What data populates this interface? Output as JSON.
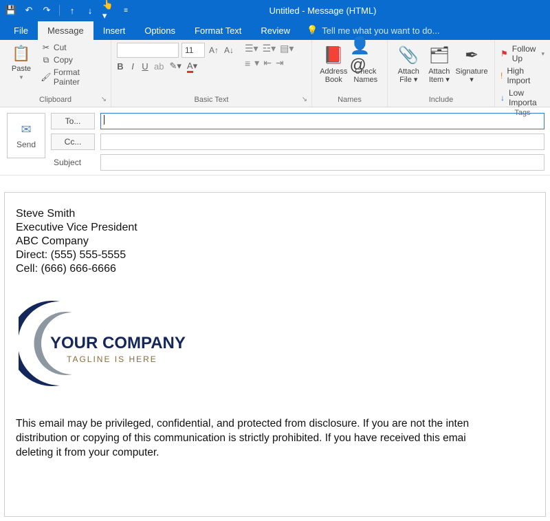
{
  "window": {
    "title": "Untitled - Message (HTML)"
  },
  "tabs": {
    "file": "File",
    "message": "Message",
    "insert": "Insert",
    "options": "Options",
    "format_text": "Format Text",
    "review": "Review",
    "tellme": "Tell me what you want to do..."
  },
  "ribbon": {
    "clipboard": {
      "label": "Clipboard",
      "paste": "Paste",
      "cut": "Cut",
      "copy": "Copy",
      "format_painter": "Format Painter"
    },
    "basic_text": {
      "label": "Basic Text",
      "font_size": "11"
    },
    "names": {
      "label": "Names",
      "address_book": "Address Book",
      "check_names": "Check Names"
    },
    "include": {
      "label": "Include",
      "attach_file": "Attach File",
      "attach_item": "Attach Item",
      "signature": "Signature"
    },
    "tags": {
      "label": "Tags",
      "follow_up": "Follow Up",
      "high": "High Import",
      "low": "Low Importa"
    }
  },
  "header": {
    "send": "Send",
    "to": "To...",
    "cc": "Cc...",
    "subject_label": "Subject",
    "to_value": "",
    "cc_value": "",
    "subject_value": ""
  },
  "signature": {
    "name": "Steve Smith",
    "title": "Executive Vice President",
    "company": "ABC Company",
    "direct": "Direct: (555) 555-5555",
    "cell": "Cell: (666) 666-6666"
  },
  "logo": {
    "text": "YOUR COMPANY",
    "tagline": "TAGLINE IS HERE"
  },
  "disclaimer": {
    "line1": "This email may be privileged, confidential, and protected from disclosure.  If you are not the inten",
    "line2": "distribution or copying of this communication is strictly prohibited.  If you have received this emai",
    "line3": "deleting it from your computer."
  },
  "colors": {
    "brand_blue": "#0a6cce",
    "logo_navy": "#14275b",
    "logo_gray": "#8d97a2"
  }
}
